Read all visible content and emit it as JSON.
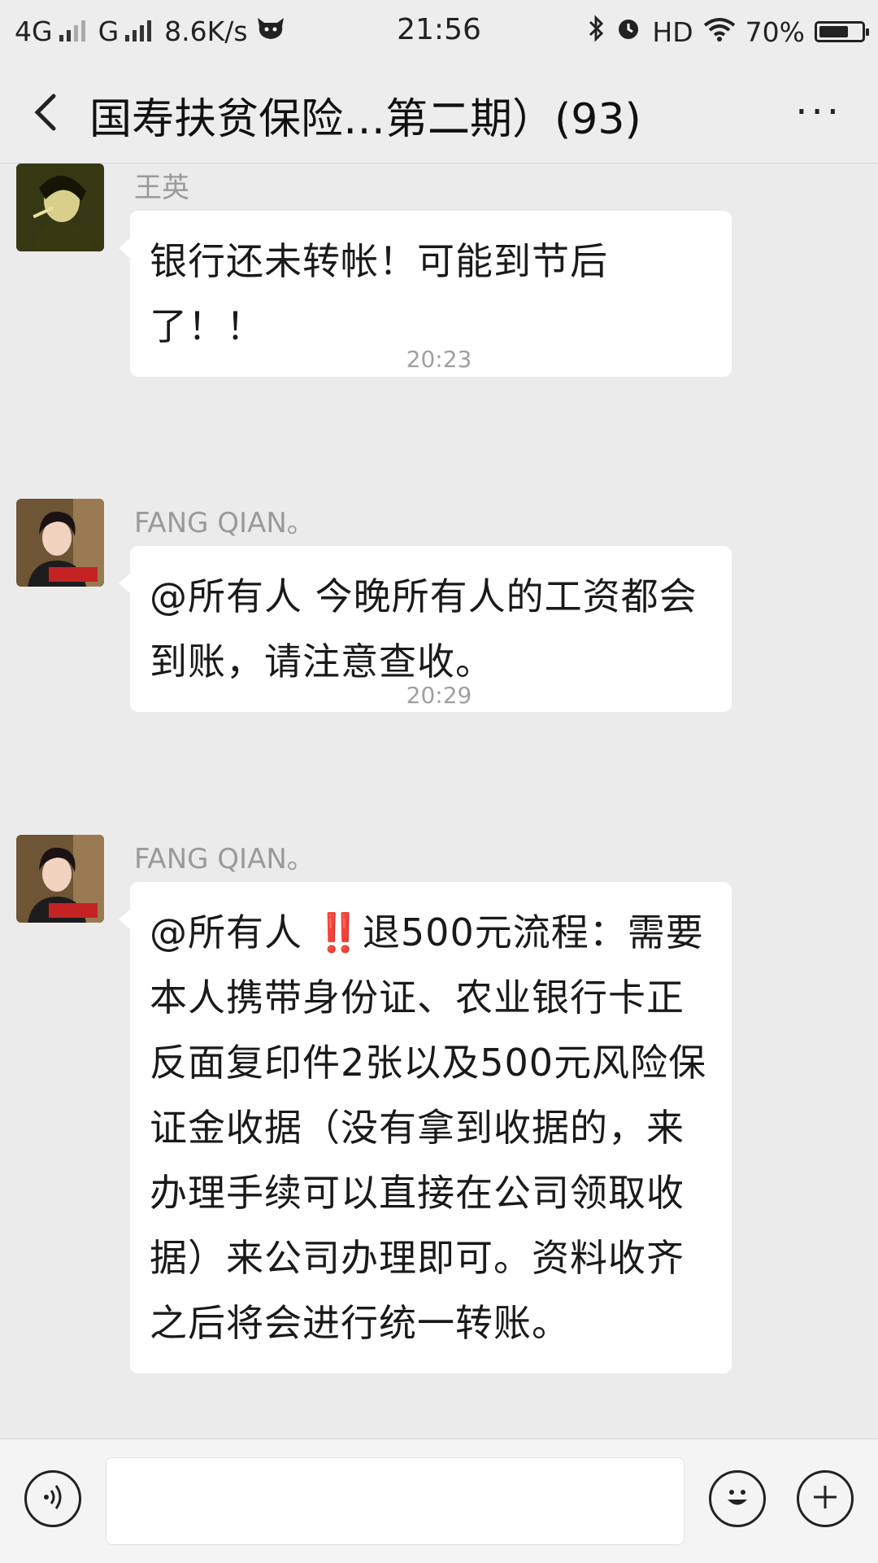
{
  "status_bar": {
    "network1": "4G",
    "network2": "G",
    "speed": "8.6K/s",
    "time": "21:56",
    "hd": "HD",
    "battery": "70%",
    "battery_level": 0.7
  },
  "header": {
    "title": "国寿扶贫保险…第二期）(93)"
  },
  "messages": [
    {
      "sender": "王英",
      "text": "银行还未转帐！可能到节后了！！"
    },
    {
      "time": "20:23",
      "sender": "FANG QIAN。",
      "text": "@所有人 今晚所有人的工资都会到账，请注意查收。"
    },
    {
      "time": "20:29",
      "sender": "FANG QIAN。",
      "text_prefix": "@所有人  ",
      "alert": "‼️",
      "text": "退500元流程：需要本人携带身份证、农业银行卡正反面复印件2张以及500元风险保证金收据（没有拿到收据的，来办理手续可以直接在公司领取收据）来公司办理即可。资料收齐之后将会进行统一转账。"
    }
  ],
  "input_bar": {
    "placeholder": ""
  }
}
